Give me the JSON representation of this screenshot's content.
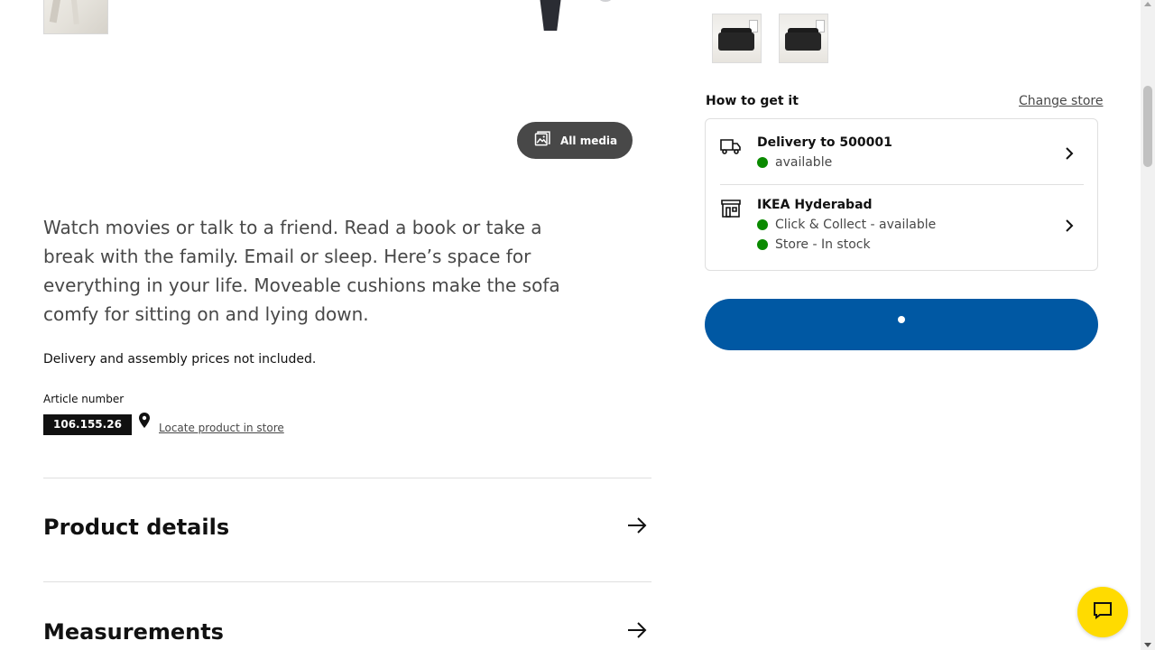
{
  "media": {
    "all_media_label": "All media",
    "all_media_icon": "image-gallery-icon"
  },
  "product": {
    "description": "Watch movies or talk to a friend. Read a book or take a break with the family. Email or sleep. Here’s space for everything in your life. Moveable cushions make the sofa comfy for sitting on and lying down.",
    "price_note": "Delivery and assembly prices not included.",
    "article_label": "Article number",
    "article_number": "106.155.26",
    "locate_link": "Locate product in store"
  },
  "sections": [
    {
      "title": "Product details"
    },
    {
      "title": "Measurements"
    }
  ],
  "how_to_get": {
    "title": "How to get it",
    "change_store": "Change store",
    "delivery": {
      "icon": "truck-icon",
      "heading": "Delivery to 500001",
      "status": "available"
    },
    "store": {
      "icon": "store-icon",
      "heading": "IKEA Hyderabad",
      "statuses": [
        "Click & Collect - available",
        "Store - In stock"
      ]
    }
  },
  "colors": {
    "primary_blue": "#0058a3",
    "available_green": "#0a8a00",
    "chat_yellow": "#ffdb00"
  }
}
